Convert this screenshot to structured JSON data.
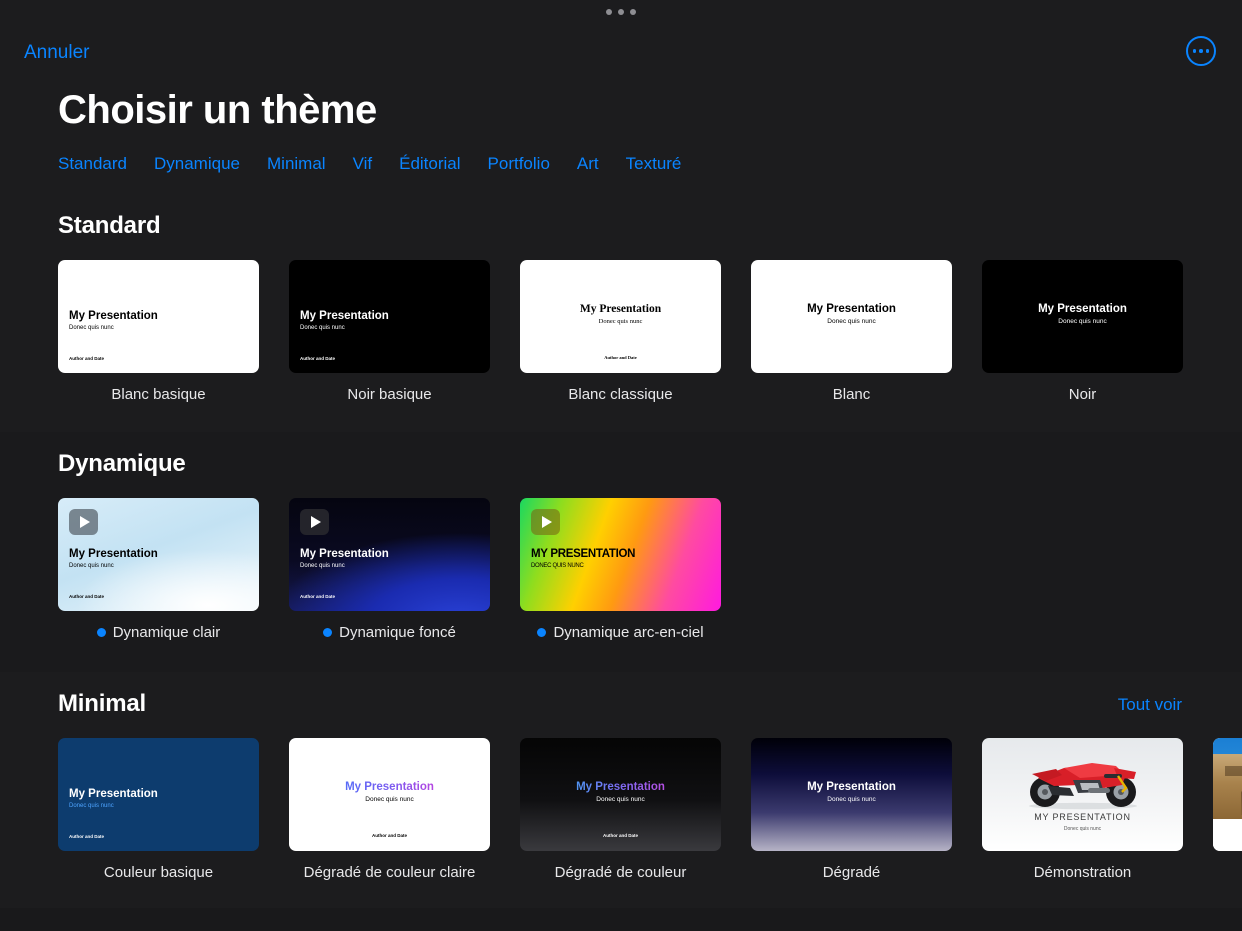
{
  "window": {
    "grabber_dots": 3
  },
  "topbar": {
    "cancel_label": "Annuler",
    "more_icon": "ellipsis-circle-icon"
  },
  "header": {
    "title": "Choisir un thème"
  },
  "category_nav": {
    "items": [
      {
        "label": "Standard"
      },
      {
        "label": "Dynamique"
      },
      {
        "label": "Minimal"
      },
      {
        "label": "Vif"
      },
      {
        "label": "Éditorial"
      },
      {
        "label": "Portfolio"
      },
      {
        "label": "Art"
      },
      {
        "label": "Texturé"
      }
    ]
  },
  "slide_text": {
    "title": "My Presentation",
    "subtitle": "Donec quis nunc",
    "author": "Author and Date",
    "title_upper": "MY PRESENTATION",
    "subtitle_upper": "DONEC QUIS NUNC"
  },
  "colors": {
    "accent_blue": "#0a84ff",
    "page_background": "#1c1c1e",
    "alt_band_background": "#1a1a1c",
    "text_primary": "#ffffff",
    "label_text": "#e8e8ea",
    "grabber_dot": "#8e8e93"
  },
  "sections": [
    {
      "title": "Standard",
      "see_all": null,
      "themes": [
        {
          "name": "Blanc basique"
        },
        {
          "name": "Noir basique"
        },
        {
          "name": "Blanc classique"
        },
        {
          "name": "Blanc"
        },
        {
          "name": "Noir"
        }
      ]
    },
    {
      "title": "Dynamique",
      "see_all": null,
      "themes": [
        {
          "name": "Dynamique clair",
          "animated": true
        },
        {
          "name": "Dynamique foncé",
          "animated": true
        },
        {
          "name": "Dynamique arc-en-ciel",
          "animated": true
        }
      ]
    },
    {
      "title": "Minimal",
      "see_all": "Tout voir",
      "themes": [
        {
          "name": "Couleur basique"
        },
        {
          "name": "Dégradé de couleur claire"
        },
        {
          "name": "Dégradé de couleur"
        },
        {
          "name": "Dégradé"
        },
        {
          "name": "Démonstration"
        },
        {
          "name": ""
        }
      ]
    }
  ]
}
